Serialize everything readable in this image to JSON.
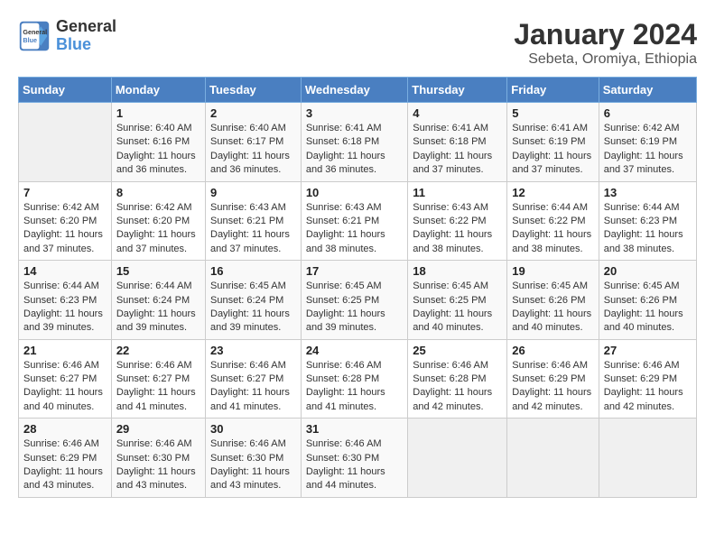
{
  "header": {
    "logo_line1": "General",
    "logo_line2": "Blue",
    "month": "January 2024",
    "location": "Sebeta, Oromiya, Ethiopia"
  },
  "days_of_week": [
    "Sunday",
    "Monday",
    "Tuesday",
    "Wednesday",
    "Thursday",
    "Friday",
    "Saturday"
  ],
  "weeks": [
    [
      {
        "day": "",
        "info": ""
      },
      {
        "day": "1",
        "info": "Sunrise: 6:40 AM\nSunset: 6:16 PM\nDaylight: 11 hours and 36 minutes."
      },
      {
        "day": "2",
        "info": "Sunrise: 6:40 AM\nSunset: 6:17 PM\nDaylight: 11 hours and 36 minutes."
      },
      {
        "day": "3",
        "info": "Sunrise: 6:41 AM\nSunset: 6:18 PM\nDaylight: 11 hours and 36 minutes."
      },
      {
        "day": "4",
        "info": "Sunrise: 6:41 AM\nSunset: 6:18 PM\nDaylight: 11 hours and 37 minutes."
      },
      {
        "day": "5",
        "info": "Sunrise: 6:41 AM\nSunset: 6:19 PM\nDaylight: 11 hours and 37 minutes."
      },
      {
        "day": "6",
        "info": "Sunrise: 6:42 AM\nSunset: 6:19 PM\nDaylight: 11 hours and 37 minutes."
      }
    ],
    [
      {
        "day": "7",
        "info": "Sunrise: 6:42 AM\nSunset: 6:20 PM\nDaylight: 11 hours and 37 minutes."
      },
      {
        "day": "8",
        "info": "Sunrise: 6:42 AM\nSunset: 6:20 PM\nDaylight: 11 hours and 37 minutes."
      },
      {
        "day": "9",
        "info": "Sunrise: 6:43 AM\nSunset: 6:21 PM\nDaylight: 11 hours and 37 minutes."
      },
      {
        "day": "10",
        "info": "Sunrise: 6:43 AM\nSunset: 6:21 PM\nDaylight: 11 hours and 38 minutes."
      },
      {
        "day": "11",
        "info": "Sunrise: 6:43 AM\nSunset: 6:22 PM\nDaylight: 11 hours and 38 minutes."
      },
      {
        "day": "12",
        "info": "Sunrise: 6:44 AM\nSunset: 6:22 PM\nDaylight: 11 hours and 38 minutes."
      },
      {
        "day": "13",
        "info": "Sunrise: 6:44 AM\nSunset: 6:23 PM\nDaylight: 11 hours and 38 minutes."
      }
    ],
    [
      {
        "day": "14",
        "info": "Sunrise: 6:44 AM\nSunset: 6:23 PM\nDaylight: 11 hours and 39 minutes."
      },
      {
        "day": "15",
        "info": "Sunrise: 6:44 AM\nSunset: 6:24 PM\nDaylight: 11 hours and 39 minutes."
      },
      {
        "day": "16",
        "info": "Sunrise: 6:45 AM\nSunset: 6:24 PM\nDaylight: 11 hours and 39 minutes."
      },
      {
        "day": "17",
        "info": "Sunrise: 6:45 AM\nSunset: 6:25 PM\nDaylight: 11 hours and 39 minutes."
      },
      {
        "day": "18",
        "info": "Sunrise: 6:45 AM\nSunset: 6:25 PM\nDaylight: 11 hours and 40 minutes."
      },
      {
        "day": "19",
        "info": "Sunrise: 6:45 AM\nSunset: 6:26 PM\nDaylight: 11 hours and 40 minutes."
      },
      {
        "day": "20",
        "info": "Sunrise: 6:45 AM\nSunset: 6:26 PM\nDaylight: 11 hours and 40 minutes."
      }
    ],
    [
      {
        "day": "21",
        "info": "Sunrise: 6:46 AM\nSunset: 6:27 PM\nDaylight: 11 hours and 40 minutes."
      },
      {
        "day": "22",
        "info": "Sunrise: 6:46 AM\nSunset: 6:27 PM\nDaylight: 11 hours and 41 minutes."
      },
      {
        "day": "23",
        "info": "Sunrise: 6:46 AM\nSunset: 6:27 PM\nDaylight: 11 hours and 41 minutes."
      },
      {
        "day": "24",
        "info": "Sunrise: 6:46 AM\nSunset: 6:28 PM\nDaylight: 11 hours and 41 minutes."
      },
      {
        "day": "25",
        "info": "Sunrise: 6:46 AM\nSunset: 6:28 PM\nDaylight: 11 hours and 42 minutes."
      },
      {
        "day": "26",
        "info": "Sunrise: 6:46 AM\nSunset: 6:29 PM\nDaylight: 11 hours and 42 minutes."
      },
      {
        "day": "27",
        "info": "Sunrise: 6:46 AM\nSunset: 6:29 PM\nDaylight: 11 hours and 42 minutes."
      }
    ],
    [
      {
        "day": "28",
        "info": "Sunrise: 6:46 AM\nSunset: 6:29 PM\nDaylight: 11 hours and 43 minutes."
      },
      {
        "day": "29",
        "info": "Sunrise: 6:46 AM\nSunset: 6:30 PM\nDaylight: 11 hours and 43 minutes."
      },
      {
        "day": "30",
        "info": "Sunrise: 6:46 AM\nSunset: 6:30 PM\nDaylight: 11 hours and 43 minutes."
      },
      {
        "day": "31",
        "info": "Sunrise: 6:46 AM\nSunset: 6:30 PM\nDaylight: 11 hours and 44 minutes."
      },
      {
        "day": "",
        "info": ""
      },
      {
        "day": "",
        "info": ""
      },
      {
        "day": "",
        "info": ""
      }
    ]
  ]
}
